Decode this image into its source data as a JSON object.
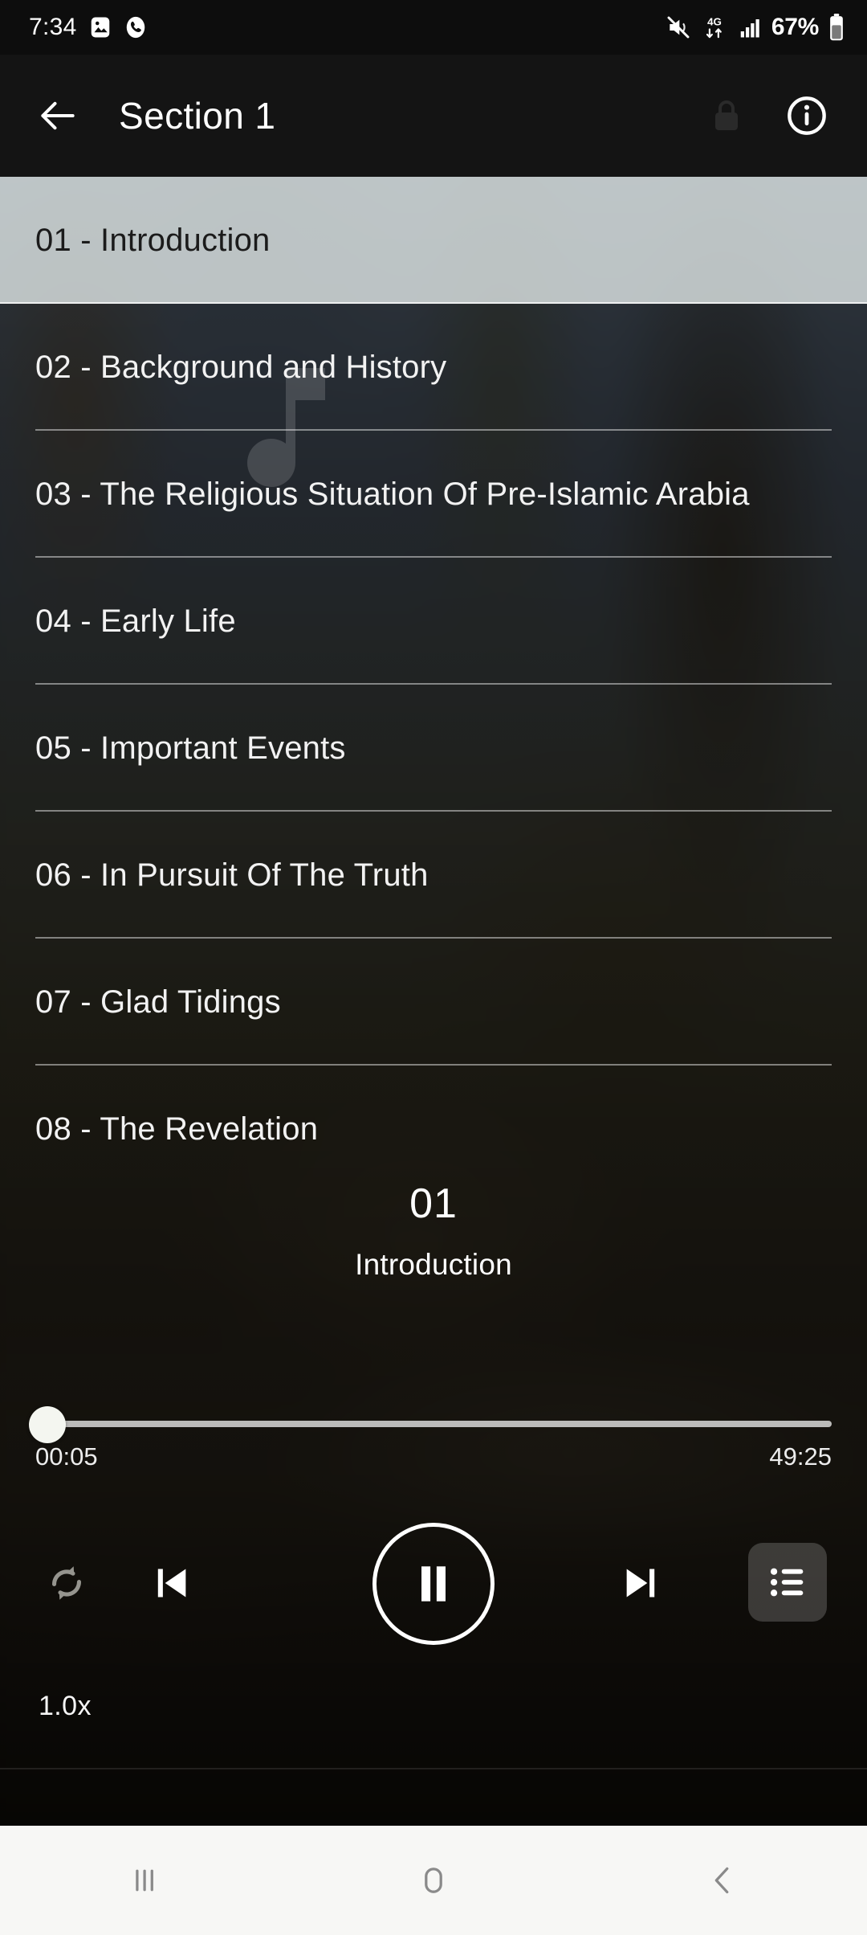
{
  "statusbar": {
    "time": "7:34",
    "battery_percent": "67%",
    "network": "4G",
    "icons": [
      "photo-icon",
      "phone-call-icon",
      "mute-icon",
      "mobile-data-icon",
      "signal-bars-icon",
      "battery-icon"
    ]
  },
  "appbar": {
    "title": "Section 1",
    "back_icon": "arrow-left-icon",
    "lock_icon": "lock-icon",
    "info_icon": "info-circle-icon"
  },
  "watermark": {
    "icon": "music-note-icon"
  },
  "chapters": [
    {
      "label": "01 - Introduction",
      "active": true
    },
    {
      "label": "02 - Background and History",
      "active": false
    },
    {
      "label": "03 - The Religious Situation Of Pre-Islamic Arabia",
      "active": false
    },
    {
      "label": "04 - Early Life",
      "active": false
    },
    {
      "label": "05 - Important Events",
      "active": false
    },
    {
      "label": "06 - In Pursuit Of The Truth",
      "active": false
    },
    {
      "label": "07 - Glad Tidings",
      "active": false
    },
    {
      "label": "08 - The Revelation",
      "active": false
    }
  ],
  "now_playing": {
    "number": "01",
    "title": "Introduction"
  },
  "seek": {
    "elapsed": "00:05",
    "duration": "49:25",
    "progress_percent": 0.2
  },
  "controls": {
    "repeat_icon": "repeat-icon",
    "previous_icon": "skip-previous-icon",
    "play_pause_icon": "pause-icon",
    "next_icon": "skip-next-icon",
    "queue_icon": "playlist-icon"
  },
  "speed": {
    "label": "1.0x"
  },
  "navbar": {
    "recents_icon": "recents-icon",
    "home_icon": "home-icon",
    "back_icon": "back-chevron-icon"
  },
  "colors": {
    "appbar_bg": "#141414",
    "statusbar_bg": "#0d0d0d",
    "active_row_bg": "#e1e8e8",
    "accent_text": "#ffffff",
    "navbar_bg": "#f7f7f5"
  }
}
